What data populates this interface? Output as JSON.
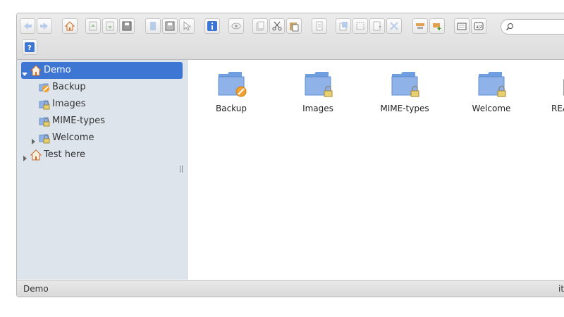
{
  "toolbar": {
    "icons": [
      "back-icon",
      "forward-icon",
      "home-icon",
      "upload-icon",
      "download-icon",
      "save-icon",
      "copy-icon",
      "save2-icon",
      "select-icon",
      "info-icon",
      "preview-icon",
      "duplicate-icon",
      "cut-icon",
      "paste-icon",
      "rename-icon",
      "extract-icon",
      "select-all-icon",
      "archive-icon",
      "resize-icon",
      "sort-icon",
      "view-icon",
      "list-view-icon",
      "sort-az-icon",
      "help-icon"
    ]
  },
  "search": {
    "placeholder": ""
  },
  "tree": {
    "root": "Demo",
    "children": [
      "Backup",
      "Images",
      "MIME-types",
      "Welcome"
    ],
    "second_root": "Test here"
  },
  "files": [
    {
      "name": "Backup",
      "badge": "no-access"
    },
    {
      "name": "Images",
      "badge": "locked"
    },
    {
      "name": "MIME-types",
      "badge": "locked"
    },
    {
      "name": "Welcome",
      "badge": "locked"
    },
    {
      "name": "REA",
      "badge": "file"
    }
  ],
  "status": {
    "path": "Demo",
    "right": "it"
  },
  "colors": {
    "selection": "#3d76d3",
    "sidebar": "#dde4ec",
    "folder": "#6e9fe0"
  }
}
